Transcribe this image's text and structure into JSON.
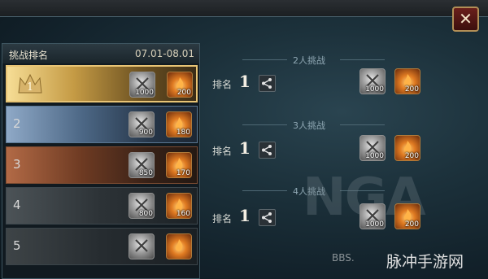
{
  "close_label": "✕",
  "ranking": {
    "title": "挑战排名",
    "dates": "07.01-08.01",
    "rows": [
      {
        "rank": "1",
        "silver": "1000",
        "fire": "200"
      },
      {
        "rank": "2",
        "silver": "900",
        "fire": "180"
      },
      {
        "rank": "3",
        "silver": "850",
        "fire": "170"
      },
      {
        "rank": "4",
        "silver": "800",
        "fire": "160"
      },
      {
        "rank": "5",
        "silver": "",
        "fire": ""
      }
    ]
  },
  "sections": [
    {
      "title": "2人挑战",
      "rank_label": "排名",
      "rank_value": "1",
      "silver": "1000",
      "fire": "200"
    },
    {
      "title": "3人挑战",
      "rank_label": "排名",
      "rank_value": "1",
      "silver": "1000",
      "fire": "200"
    },
    {
      "title": "4人挑战",
      "rank_label": "排名",
      "rank_value": "1",
      "silver": "1000",
      "fire": "200"
    }
  ],
  "watermark": {
    "logo_text": "NGA",
    "footer_site": "BBS.",
    "brand": "脉冲手游网"
  },
  "colors": {
    "gold": "#e8c475",
    "silver_row": "#4c6785",
    "bronze_row": "#6d3a22",
    "close_bg": "#6a1f1b"
  }
}
